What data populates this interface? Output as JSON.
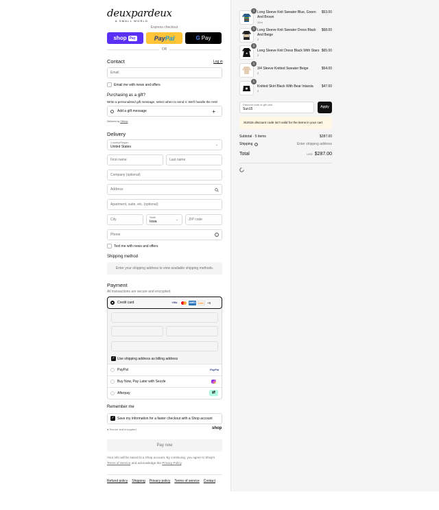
{
  "brand": {
    "logo_text": "deuxpardeux",
    "logo_sub": "A SMALL WORLD"
  },
  "express": {
    "title": "Express checkout",
    "shop_label": "shop",
    "shop_pay": "Pay",
    "paypal_pay": "Pay",
    "paypal_pal": "Pal",
    "gpay_g": "G",
    "gpay_label": "Pay",
    "or": "OR"
  },
  "contact": {
    "title": "Contact",
    "login": "Log in",
    "email_placeholder": "Email",
    "news_label": "Email me with news and offers"
  },
  "gift": {
    "title": "Purchasing as a gift?",
    "desc": "Write a personalised gift message, select when to send it. We'll handle the rest!",
    "add_label": "Add a gift message",
    "plus": "+",
    "delivered_by_prefix": "Delivered by",
    "delivered_by_link": "Giftship"
  },
  "delivery": {
    "title": "Delivery",
    "country_label": "Country/Region",
    "country_value": "United States",
    "first_name": "First name",
    "last_name": "Last name",
    "company": "Company (optional)",
    "address": "Address",
    "apartment": "Apartment, suite, etc. (optional)",
    "city": "City",
    "state_label": "State",
    "state_value": "Iowa",
    "zip": "ZIP code",
    "phone": "Phone",
    "text_label": "Text me with news and offers"
  },
  "shipping_method": {
    "title": "Shipping method",
    "message": "Enter your shipping address to view available shipping methods."
  },
  "payment": {
    "title": "Payment",
    "subtitle": "All transactions are secure and encrypted.",
    "credit_card": "Credit card",
    "card_logos": [
      "VISA",
      "MC",
      "AMEX",
      "DISC"
    ],
    "more": "+5",
    "billing_label": "Use shipping address as billing address",
    "paypal": "PayPal",
    "paypal_logo": "PayPal",
    "sezzle": "Buy Now, Pay Later with Sezzle",
    "afterpay": "Afterpay"
  },
  "remember": {
    "title": "Remember me",
    "save_label": "Save my information for a faster checkout with a Shop account",
    "secure": "Secure and encrypted",
    "shop_logo": "shop"
  },
  "pay_button": "Pay now",
  "legal": {
    "line1": "Your info will be saved to a Shop account. By continuing, you agree to Shop's",
    "terms": "Terms of Service",
    "and": "and acknowledge the",
    "privacy": "Privacy Policy",
    "end": "."
  },
  "footer": [
    "Refund policy",
    "Shipping",
    "Privacy policy",
    "Terms of service",
    "Contact"
  ],
  "cart": {
    "items": [
      {
        "name": "Long Sleeve Knit Sweater Blue, Green And Brown",
        "variant": "12m",
        "price": "$53.00",
        "qty": "1"
      },
      {
        "name": "Long Sleeve Knit Sweater Dress Black And Beige",
        "variant": "2",
        "price": "$68.00",
        "qty": "1"
      },
      {
        "name": "Long Sleeve Knit Dress Black With Stars",
        "variant": "2",
        "price": "$65.00",
        "qty": "1"
      },
      {
        "name": "3/4 Sleeve Knitted Sweater Beige",
        "variant": "2",
        "price": "$54.00",
        "qty": "1"
      },
      {
        "name": "Knitted Skirt Black With Bear Intarsia",
        "variant": "2",
        "price": "$47.00",
        "qty": "1"
      }
    ],
    "discount_label": "Discount code or gift card",
    "discount_value": "Sun15",
    "apply": "Apply",
    "error": "SUN15 discount code isn't valid for the items in your cart",
    "subtotal_label": "Subtotal · 5 items",
    "subtotal_value": "$287.00",
    "shipping_label": "Shipping",
    "shipping_value": "Enter shipping address",
    "total_label": "Total",
    "currency": "USD",
    "total_value": "$287.00"
  },
  "colors": {
    "shop_purple": "#5a31f4",
    "paypal_yellow": "#ffc439",
    "error_bg": "#fff8e6"
  }
}
